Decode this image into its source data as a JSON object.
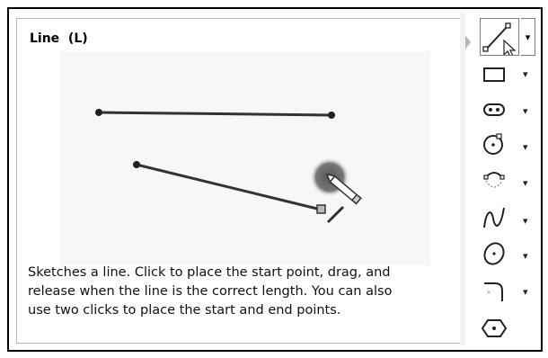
{
  "tooltip": {
    "title": "Line  (L)",
    "description_lines": [
      "Sketches a line. Click to place the start point, drag, and",
      "release when the line is the correct length. You can also",
      "use two clicks to place the start and end points."
    ]
  },
  "toolbar": {
    "items": [
      {
        "name": "line",
        "icon": "line-icon",
        "active": true
      },
      {
        "name": "rectangle",
        "icon": "rectangle-icon"
      },
      {
        "name": "slot",
        "icon": "slot-icon"
      },
      {
        "name": "circle",
        "icon": "circle-icon"
      },
      {
        "name": "arc",
        "icon": "arc-icon"
      },
      {
        "name": "spline",
        "icon": "spline-icon"
      },
      {
        "name": "ellipse",
        "icon": "ellipse-icon"
      },
      {
        "name": "fillet",
        "icon": "fillet-icon"
      },
      {
        "name": "polygon",
        "icon": "polygon-icon"
      }
    ],
    "dropdown_glyph": "▾"
  },
  "colors": {
    "accent": "#333333",
    "preview_bg": "#f7f7f7",
    "glow": "#6e6e6e"
  }
}
